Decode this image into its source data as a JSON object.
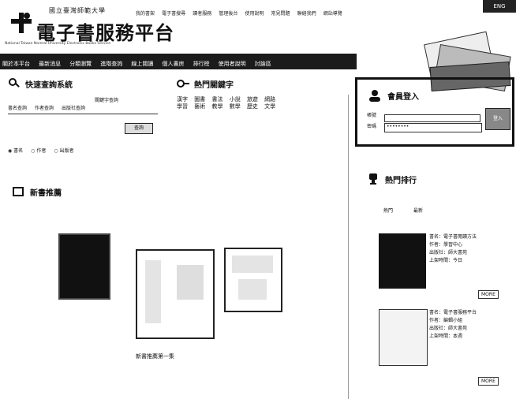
{
  "header": {
    "subtitle": "國立臺灣師範大學",
    "title": "電子書服務平台",
    "english": "National Taiwan Normal University Electronic Books Service",
    "top_links": [
      "我的書架",
      "電子書搜尋",
      "讀者服務",
      "管理後台",
      "使用說明",
      "常見問題",
      "聯絡我們",
      "網站導覽"
    ],
    "top_corner": "ENG"
  },
  "nav": {
    "items": [
      "關於本平台",
      "最新消息",
      "分類瀏覽",
      "進階查詢",
      "線上閱讀",
      "個人書房",
      "排行榜",
      "使用者說明",
      "討論區"
    ]
  },
  "search": {
    "title": "快速查詢系統",
    "field_label": "關鍵字查詢",
    "fields": [
      "書名查詢",
      "作者查詢",
      "出版社查詢"
    ],
    "button": "查詢",
    "options": [
      "書名",
      "作者",
      "出版者"
    ]
  },
  "hot": {
    "title": "熱門關鍵字",
    "keywords": [
      "漢字",
      "圖書",
      "書法",
      "小說",
      "旅遊",
      "網路",
      "學習",
      "藝術",
      "教學",
      "數學",
      "歷史",
      "文學"
    ]
  },
  "login": {
    "title": "會員登入",
    "label_user": "帳號",
    "label_pass": "密碼",
    "pass_mask": "••••••••",
    "button": "登入"
  },
  "featured": {
    "title": "新書推薦",
    "caption": "新書推薦第一集"
  },
  "ranking": {
    "title": "熱門排行",
    "tabs": [
      "熱門",
      "最新"
    ],
    "items": [
      {
        "text": [
          "書名：電子書閱讀方法",
          "作者：學習中心",
          "出版社：師大書苑",
          "上架時間：今日"
        ],
        "more": "MORE"
      },
      {
        "text": [
          "書名：電子書服務平台",
          "作者：編輯小組",
          "出版社：師大書苑",
          "上架時間：本週"
        ],
        "more": "MORE"
      }
    ]
  }
}
